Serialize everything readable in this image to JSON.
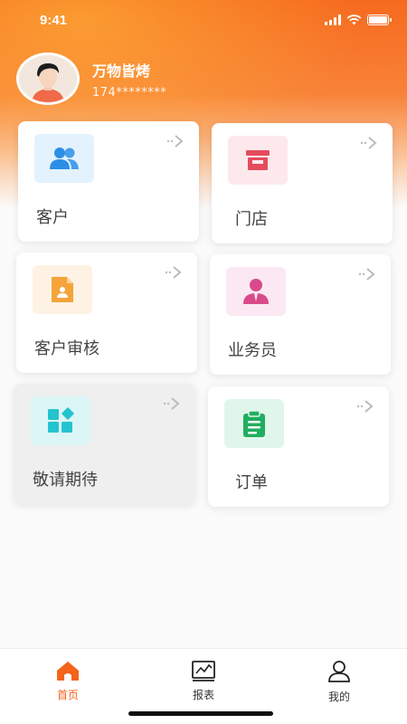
{
  "status_bar": {
    "time": "9:41"
  },
  "profile": {
    "name": "万物皆烤",
    "phone": "174********"
  },
  "cards": [
    {
      "label": "客户",
      "icon": "users-icon",
      "color": "#2b8fe8",
      "bg": "#e3f2fc"
    },
    {
      "label": "门店",
      "icon": "store-icon",
      "color": "#e44c5c",
      "bg": "#fde9ec"
    },
    {
      "label": "客户审核",
      "icon": "document-review-icon",
      "color": "#f4a43a",
      "bg": "#fdf2e4"
    },
    {
      "label": "业务员",
      "icon": "salesperson-icon",
      "color": "#d94a8b",
      "bg": "#fce8f2"
    },
    {
      "label": "敬请期待",
      "icon": "grid-apps-icon",
      "color": "#23c4cf",
      "bg": "#dcf5f6"
    },
    {
      "label": "订单",
      "icon": "clipboard-icon",
      "color": "#1fae5f",
      "bg": "#e1f6ea"
    }
  ],
  "tabbar": {
    "items": [
      {
        "label": "首页",
        "icon": "home-icon",
        "active": true
      },
      {
        "label": "报表",
        "icon": "chart-icon",
        "active": false
      },
      {
        "label": "我的",
        "icon": "user-icon",
        "active": false
      }
    ],
    "accent": "#f4641a"
  }
}
